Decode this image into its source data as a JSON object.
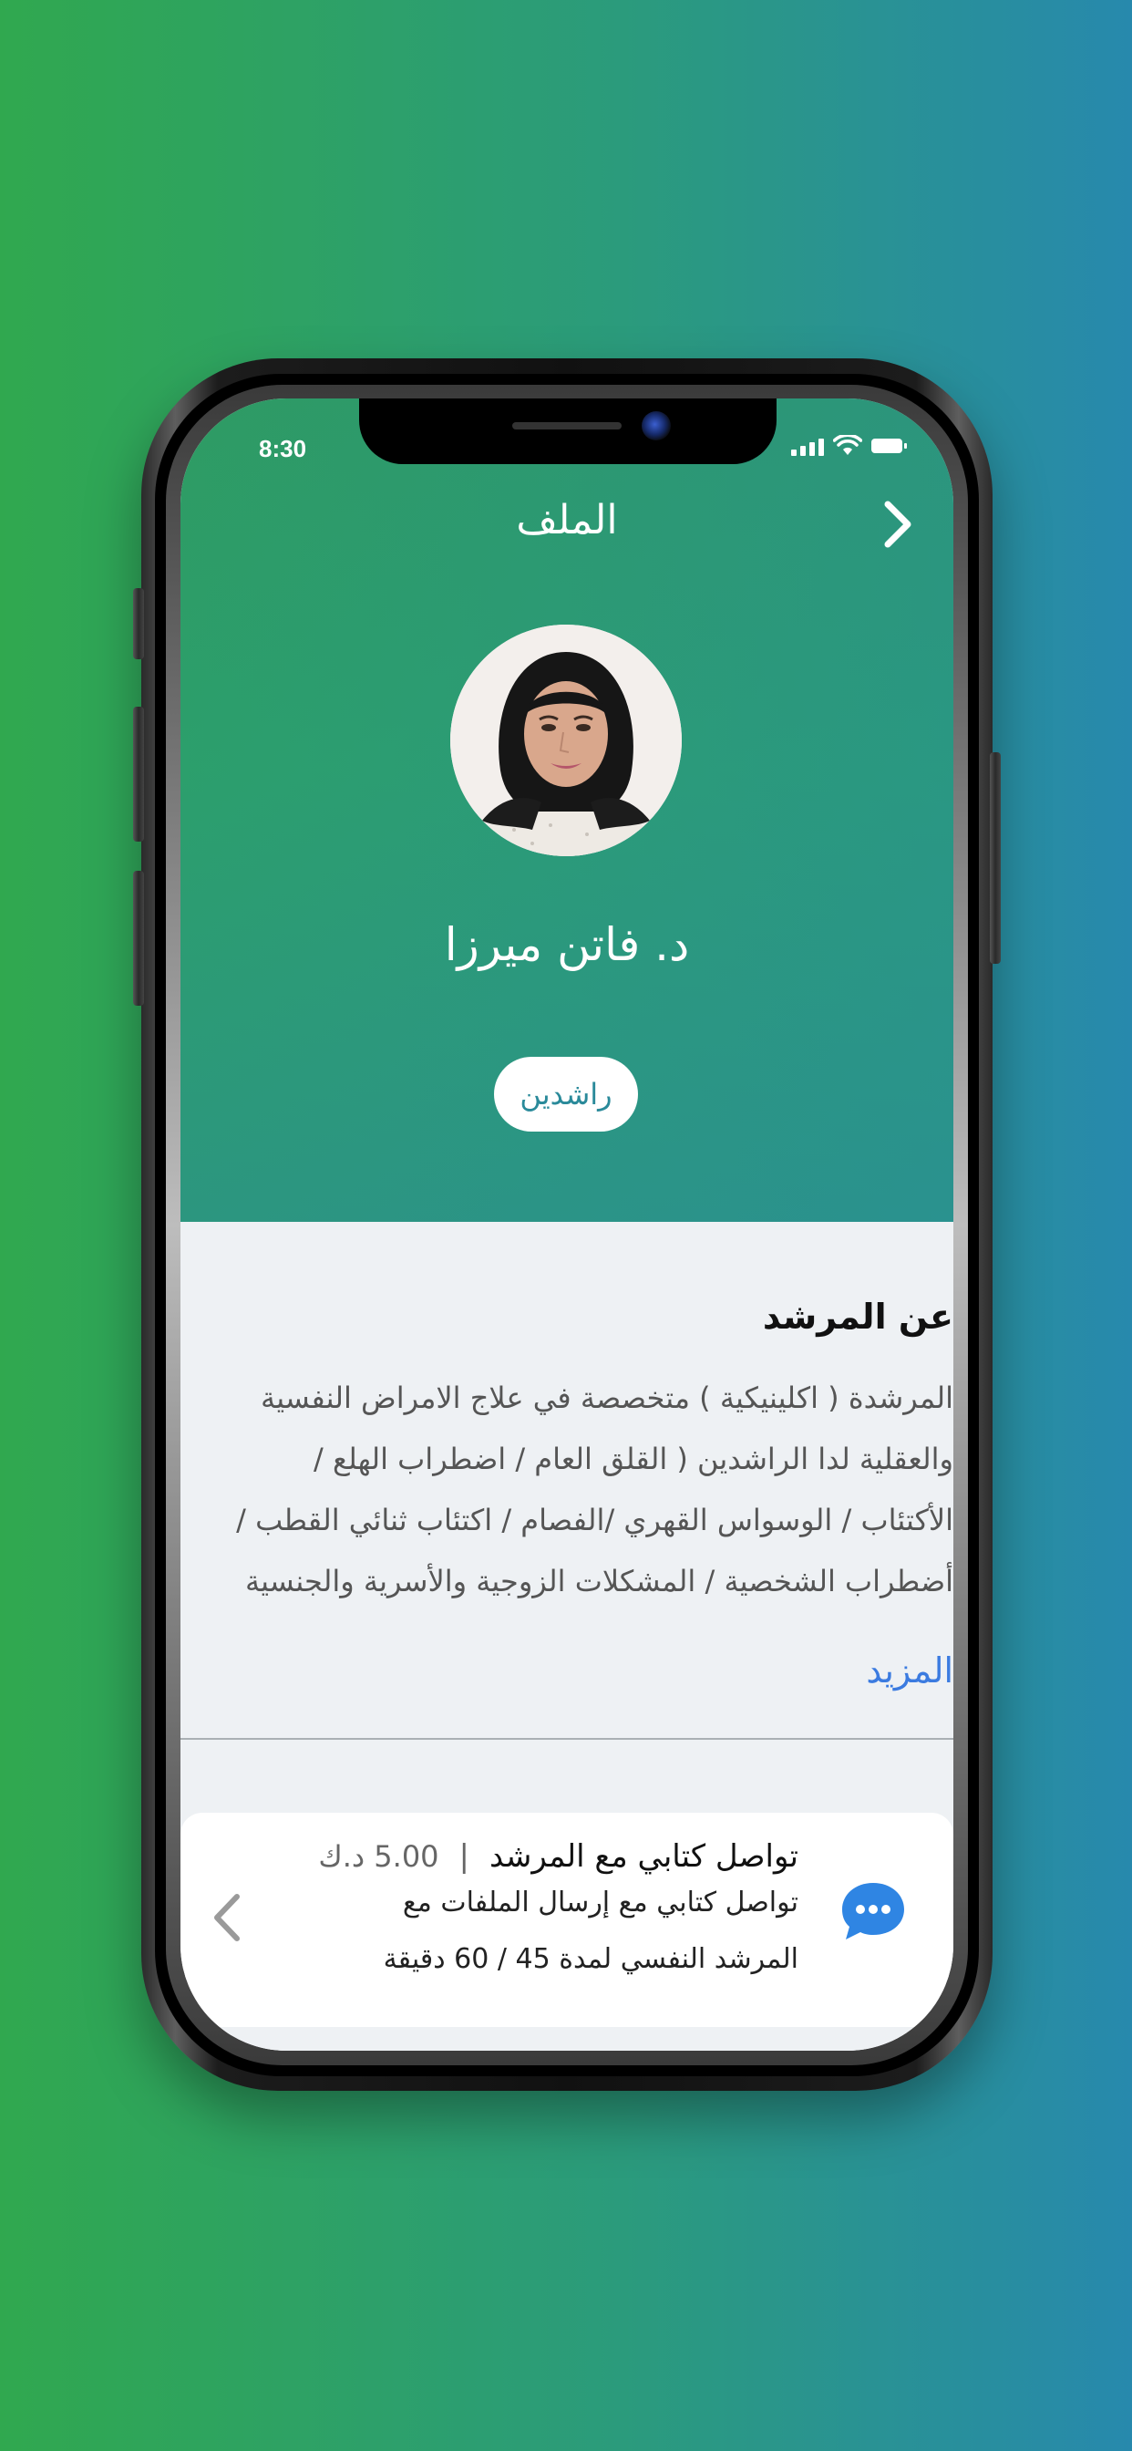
{
  "status_bar": {
    "time": "8:30"
  },
  "header": {
    "title": "الملف"
  },
  "profile": {
    "name": "د. فاتن ميرزا",
    "tag": "راشدين"
  },
  "about": {
    "title": "عن المرشد",
    "lines": [
      "المرشدة ( اكلينيكية ) متخصصة في علاج الامراض النفسية",
      "والعقلية لدا الراشدين ( القلق العام / اضطراب الهلع /",
      "الأكتئاب / الوسواس القهري /الفصام / اكتئاب ثنائي القطب /",
      "أضطراب الشخصية / المشكلات الزوجية والأسرية والجنسية"
    ],
    "more_label": "المزيد"
  },
  "service": {
    "title": "تواصل كتابي مع المرشد",
    "separator": "|",
    "price": "5.00 د.ك",
    "desc_lines": [
      "تواصل كتابي مع إرسال الملفات مع",
      "المرشد النفسي لمدة 45 / 60 دقيقة"
    ]
  },
  "icons": {
    "back": "chevron-right-icon",
    "service": "chat-bubble-icon",
    "service_action": "chevron-left-icon"
  },
  "colors": {
    "background_start": "#30a84f",
    "background_end": "#2789ad",
    "header_green": "#2e9b63",
    "tag_text": "#2a8a9a",
    "link_blue": "#3b7be0",
    "chat_icon_blue": "#2f85e3",
    "section_bg": "#eef1f4"
  }
}
